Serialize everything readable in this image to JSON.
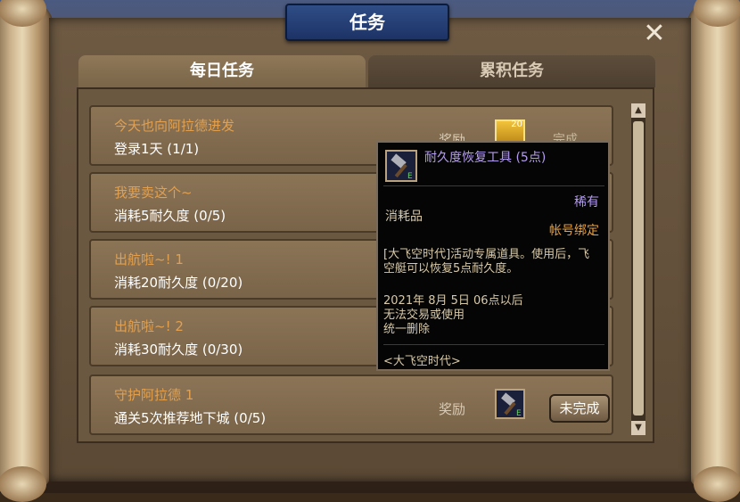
{
  "window": {
    "title": "任务",
    "close_label": "✕"
  },
  "tabs": [
    {
      "label": "每日任务",
      "active": true
    },
    {
      "label": "累积任务",
      "active": false
    }
  ],
  "reward_label": "奖励",
  "quests": [
    {
      "title": "今天也向阿拉德进发",
      "desc": "登录1天 (1/1)",
      "reward_item": "gold-coin-icon",
      "reward_count": "20",
      "status": "完成"
    },
    {
      "title": "我要卖这个~",
      "desc": "消耗5耐久度 (0/5)"
    },
    {
      "title": "出航啦~! 1",
      "desc": "消耗20耐久度 (0/20)"
    },
    {
      "title": "出航啦~! 2",
      "desc": "消耗30耐久度 (0/30)"
    },
    {
      "title": "守护阿拉德 1",
      "desc": "通关5次推荐地下城 (0/5)",
      "reward_item": "hammer-icon",
      "button": "未完成"
    }
  ],
  "tooltip": {
    "name": "耐久度恢复工具 (5点)",
    "rarity": "稀有",
    "category": "消耗品",
    "bind": "帐号绑定",
    "description": "[大飞空时代]活动专属道具。使用后，飞空艇可以恢复5点耐久度。",
    "limit_line1": "2021年 8月 5日 06点以后",
    "limit_line2": "无法交易或使用",
    "limit_line3": "统一删除",
    "footer": "<大飞空时代>"
  },
  "colors": {
    "quest_title": "#e2a04e",
    "rarity": "#b49cf0",
    "bind": "#e8a040",
    "banner": "#2f4d86"
  }
}
